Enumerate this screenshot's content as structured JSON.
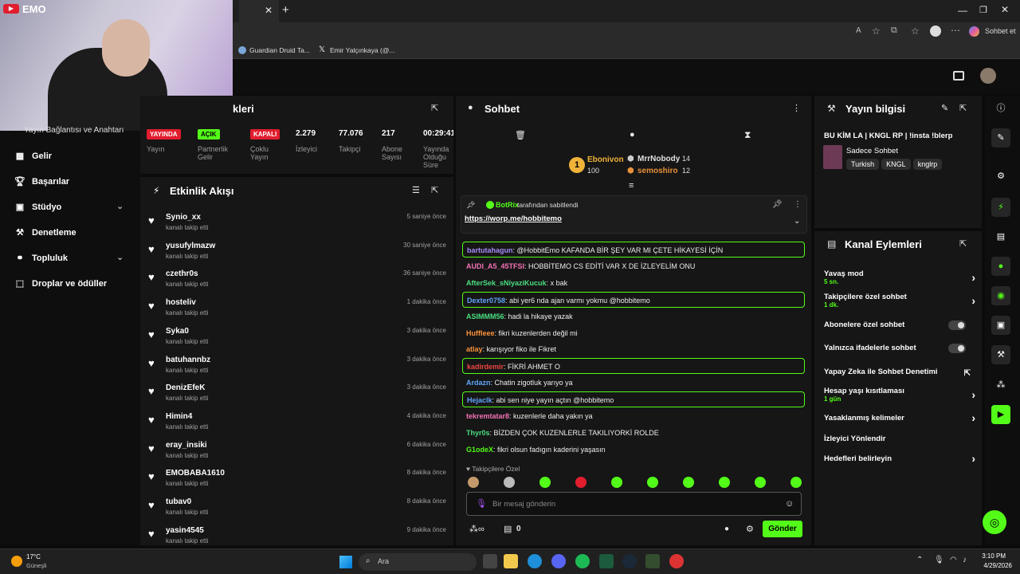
{
  "browser": {
    "tab1": "Guardian Druid Ta...",
    "tab2": "Emir Yalçınkaya (@...",
    "copilot": "Sohbet et",
    "overlay_brand": "EMO"
  },
  "sidebar": {
    "cut_title": "Yayın Bağlantısı ve Anahtarı",
    "items": [
      {
        "label": "Gelir"
      },
      {
        "label": "Başarılar"
      },
      {
        "label": "Stüdyo"
      },
      {
        "label": "Denetleme"
      },
      {
        "label": "Topluluk"
      },
      {
        "label": "Droplar ve ödüller"
      }
    ]
  },
  "stats": {
    "title_fragment": "kleri",
    "items": [
      {
        "badge": "YAYINDA",
        "label": "Yayın"
      },
      {
        "badge": "AÇIK",
        "label": "Partnerlik Gelir"
      },
      {
        "badge": "KAPALI",
        "label": "Çoklu Yayın"
      },
      {
        "value": "2.279",
        "label": "İzleyici"
      },
      {
        "value": "77.076",
        "label": "Takipçi"
      },
      {
        "value": "217",
        "label": "Abone Sayısı"
      },
      {
        "value": "00:29:41",
        "label": "Yayında Olduğu Süre"
      }
    ]
  },
  "feed": {
    "title": "Etkinlik Akışı",
    "items": [
      {
        "name": "Synio_xx",
        "sub": "kanalı takip etti",
        "time": "5 saniye önce"
      },
      {
        "name": "yusufylmazw",
        "sub": "kanalı takip etti",
        "time": "30 saniye önce"
      },
      {
        "name": "czethr0s",
        "sub": "kanalı takip etti",
        "time": "36 saniye önce"
      },
      {
        "name": "hosteliv",
        "sub": "kanalı takip etti",
        "time": "1 dakika önce"
      },
      {
        "name": "Syka0",
        "sub": "kanalı takip etti",
        "time": "3 dakika önce"
      },
      {
        "name": "batuhannbz",
        "sub": "kanalı takip etti",
        "time": "3 dakika önce"
      },
      {
        "name": "DenizEfeK",
        "sub": "kanalı takip etti",
        "time": "3 dakika önce"
      },
      {
        "name": "Himin4",
        "sub": "kanalı takip etti",
        "time": "4 dakika önce"
      },
      {
        "name": "eray_insiki",
        "sub": "kanalı takip etti",
        "time": "6 dakika önce"
      },
      {
        "name": "EMOBABA1610",
        "sub": "kanalı takip etti",
        "time": "8 dakika önce"
      },
      {
        "name": "tubav0",
        "sub": "kanalı takip etti",
        "time": "8 dakika önce"
      },
      {
        "name": "yasin4545",
        "sub": "kanalı takip etti",
        "time": "9 dakika önce"
      }
    ]
  },
  "chat": {
    "title": "Sohbet",
    "top": [
      {
        "rank": "1",
        "name": "Ebonivon",
        "value": "100"
      },
      {
        "name": "MrrNobody",
        "value": "14"
      },
      {
        "name": "semoshiro",
        "value": "12"
      }
    ],
    "pinned_by": "BotRix",
    "pinned_suffix": "tarafından sabitlendi",
    "pinned_link": "https://worp.me/hobbitemo",
    "messages": [
      {
        "user": "bartutahagun",
        "text": "@HobbitEmo KAFANDA BİR ŞEY VAR MI ÇETE HİKAYESİ İÇİN",
        "color": "#a78bfa"
      },
      {
        "user": "AUDI_A5_45TFSI",
        "text": "HOBBİTEMO CS EDİTİ VAR X DE İZLEYELİM ONU",
        "color": "#f472b6"
      },
      {
        "user": "AfterSek_sNiyaziKucuk",
        "text": "x bak",
        "color": "#4ade80"
      },
      {
        "user": "Dexter0758",
        "text": "abi yer6 nda ajan varmı yokmu @hobbitemo",
        "color": "#60a5fa"
      },
      {
        "user": "ASIMMM56",
        "text": "hadi la hikaye yazak",
        "color": "#4ade80"
      },
      {
        "user": "Huffleee",
        "text": "fikri kuzenlerden değil mi",
        "color": "#fb923c"
      },
      {
        "user": "atlay",
        "text": "karışıyor fiko ile Fikret",
        "color": "#fb923c"
      },
      {
        "user": "kadirdemir",
        "text": "FİKRİ AHMET O",
        "color": "#ef4444"
      },
      {
        "user": "Ardazn",
        "text": "Chatin zigotluk yarıyo ya",
        "color": "#60a5fa"
      },
      {
        "user": "Hejaclk",
        "text": "abi sen niye yayın açtın @hobbitemo",
        "color": "#60a5fa"
      },
      {
        "user": "tekremtatar8",
        "text": "kuzenlerle daha yakın ya",
        "color": "#f472b6"
      },
      {
        "user": "Thyr0s",
        "text": "BİZDEN ÇOK KUZENLERLE TAKILIYORKİ ROLDE",
        "color": "#4ade80"
      },
      {
        "user": "G1odeX",
        "text": "fikri olsun fadıgın kaderini yaşasın",
        "color": "#53fc18"
      }
    ],
    "followers_only": "Takipçilere Özel",
    "placeholder": "Bir mesaj gönderin",
    "points": "0",
    "send": "Gönder"
  },
  "stream_info": {
    "title": "Yayın bilgisi",
    "stream_title": "BU KİM LA | KNGL RP | !insta !blerp",
    "category": "Sadece Sohbet",
    "tags": [
      "Turkish",
      "KNGL",
      "knglrp"
    ]
  },
  "channel_actions": {
    "title": "Kanal Eylemleri",
    "items": [
      {
        "label": "Yavaş mod",
        "sub": "5 sn."
      },
      {
        "label": "Takipçilere özel sohbet",
        "sub": "1 dk."
      },
      {
        "label": "Abonelere özel sohbet"
      },
      {
        "label": "Yalnızca ifadelerle sohbet"
      },
      {
        "label": "Yapay Zeka ile Sohbet Denetimi"
      },
      {
        "label": "Hesap yaşı kısıtlaması",
        "sub": "1 gün"
      },
      {
        "label": "Yasaklanmış kelimeler"
      },
      {
        "label": "İzleyici Yönlendir"
      },
      {
        "label": "Hedefleri belirleyin"
      }
    ]
  },
  "taskbar": {
    "temp": "17°C",
    "weather": "Güneşli",
    "search": "Ara",
    "time": "3:10 PM",
    "date": "4/29/2026"
  },
  "colors": {
    "accent": "#53fc18",
    "panel": "#161616",
    "live_red": "#e11d2e"
  }
}
